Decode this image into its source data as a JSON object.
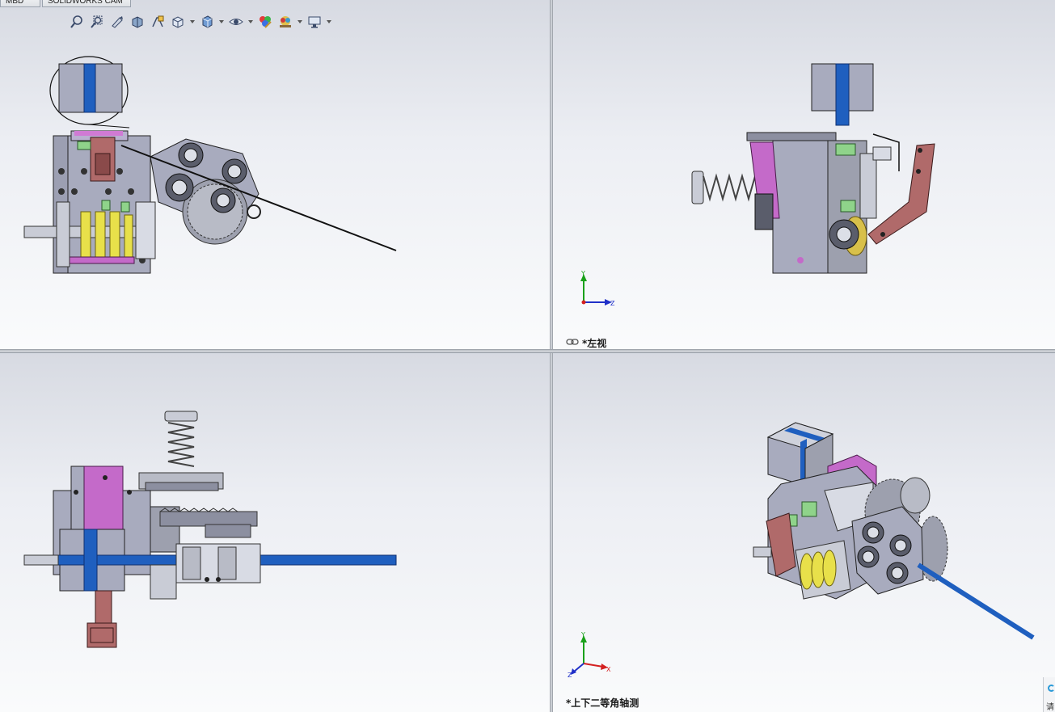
{
  "tabs": [
    {
      "label": "MBD"
    },
    {
      "label": "SOLIDWORKS CAM"
    }
  ],
  "heads_up_toolbar": {
    "tools": [
      {
        "icon": "zoom-to-fit-icon"
      },
      {
        "icon": "zoom-to-area-icon"
      },
      {
        "icon": "previous-view-icon"
      },
      {
        "icon": "section-view-icon"
      },
      {
        "icon": "dynamic-annotation-icon"
      },
      {
        "icon": "view-orientation-icon"
      },
      {
        "icon": "display-style-icon"
      },
      {
        "icon": "hide-show-items-icon"
      },
      {
        "icon": "edit-appearance-icon"
      },
      {
        "icon": "apply-scene-icon"
      },
      {
        "icon": "view-settings-icon"
      }
    ]
  },
  "viewports": {
    "top_right": {
      "label": "*左视",
      "triad_axes": [
        "Y",
        "Z"
      ]
    },
    "bottom_right": {
      "label": "*上下二等角轴测",
      "triad_axes": [
        "Y",
        "X",
        "Z"
      ]
    }
  },
  "corner_widget": {
    "glyph": "请"
  },
  "colors": {
    "viewport_top": "#d7dae2",
    "viewport_bottom": "#fafbfc",
    "part_gray": "#a8abbe",
    "part_dark": "#5a5d6b",
    "blue_strap": "#1f5fbf",
    "magenta": "#c46ac9",
    "yellow": "#e8e04a",
    "brown": "#b06a6a",
    "green": "#8fd38a",
    "triad_y": "#1aa11a",
    "triad_x": "#d42020",
    "triad_z": "#2030c8"
  }
}
